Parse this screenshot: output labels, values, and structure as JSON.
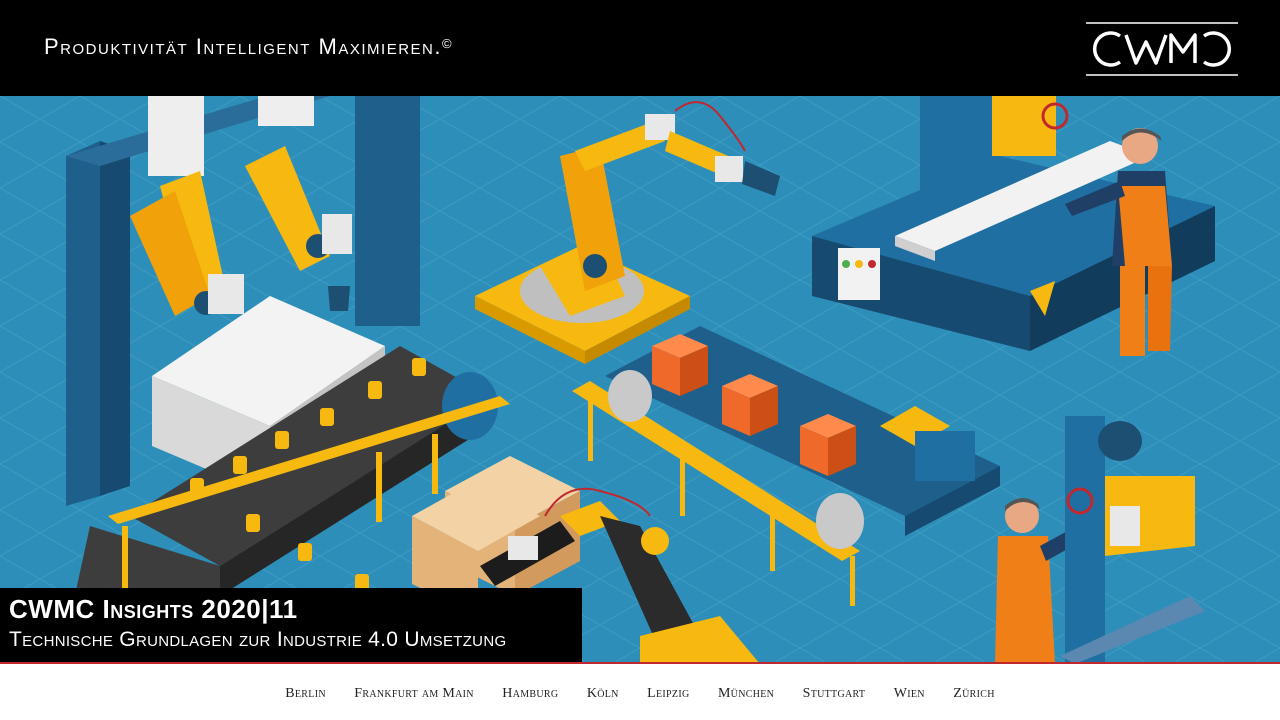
{
  "header": {
    "tagline": "Produktivität Intelligent Maximieren.",
    "tagline_mark": "©",
    "logo_text": "CWMC"
  },
  "title_box": {
    "main": "CWMC Insights 2020|11",
    "sub": "Technische Grundlagen zur Industrie 4.0 Umsetzung"
  },
  "footer": {
    "cities": [
      "Berlin",
      "Frankfurt am Main",
      "Hamburg",
      "Köln",
      "Leipzig",
      "München",
      "Stuttgart",
      "Wien",
      "Zürich"
    ]
  },
  "colors": {
    "header_bg": "#000000",
    "hero_bg": "#2d8fb9",
    "accent_red": "#c0282d",
    "robot_yellow": "#f7b90f",
    "crate_orange": "#ef6a2a"
  }
}
